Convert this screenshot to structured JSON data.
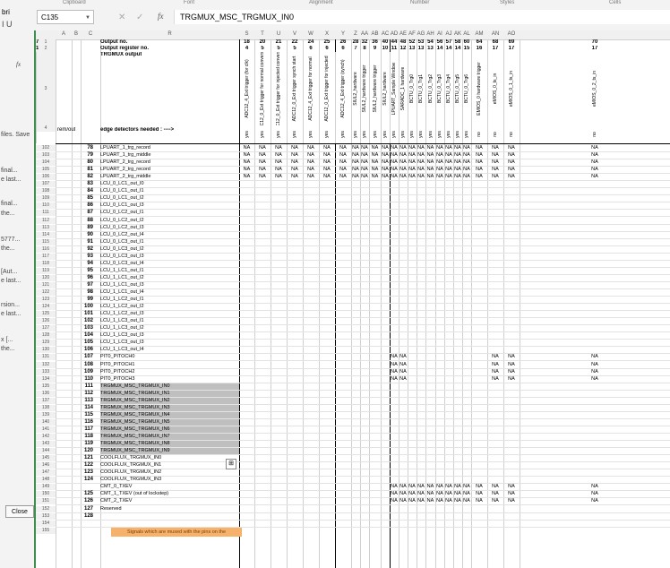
{
  "ribbon": {
    "groups": [
      "Clipboard",
      "Font",
      "Alignment",
      "Number",
      "Styles",
      "Cells"
    ]
  },
  "font": {
    "name": "bri",
    "buttons": "I  U"
  },
  "name_box": {
    "value": "C135"
  },
  "formula_bar": {
    "fx": "fx",
    "value": "TRGMUX_MSC_TRGMUX_IN0",
    "cancel": "✕",
    "confirm": "✓"
  },
  "left_panel": {
    "fx_label": "fx",
    "items": [
      "files. Save",
      "final...",
      "e last...",
      "final...",
      "the...",
      "5777...",
      "the...",
      "[Aut...",
      "e last...",
      "rsion...",
      "e last...",
      "x [...",
      "the..."
    ],
    "close_label": "Close"
  },
  "columns": [
    "A",
    "B",
    "C",
    "R",
    "S",
    "T",
    "U",
    "V",
    "W",
    "X",
    "Y",
    "Z",
    "AA",
    "AB",
    "AC",
    "AD",
    "AE",
    "AF",
    "AG",
    "AH",
    "AI",
    "AJ",
    "AK",
    "AL",
    "AM",
    "AN",
    "AO"
  ],
  "header": {
    "output_no_label": "Output no.",
    "output_reg_label": "Output register no.",
    "trgmux_label": "TRGMUX output",
    "edge_label": "edge detectors needed : ---->",
    "row4_left": "rem/out",
    "output_no": [
      "18",
      "20",
      "21",
      "22",
      "24",
      "25",
      "26",
      "28",
      "32",
      "36",
      "40",
      "44",
      "48",
      "52",
      "53",
      "54",
      "56",
      "57",
      "58",
      "60",
      "64",
      "68",
      "69",
      "70",
      "7"
    ],
    "output_reg": [
      "4",
      "5",
      "5",
      "5",
      "6",
      "6",
      "6",
      "7",
      "8",
      "9",
      "10",
      "11",
      "12",
      "13",
      "13",
      "13",
      "14",
      "14",
      "14",
      "15",
      "16",
      "17",
      "17",
      "17",
      "1"
    ],
    "outputs": [
      "ADC12_4_Ext trigger (for clk)",
      "ADC12_0_Ext trigger for normal conversion",
      "ADC12_0_Ext trigger for injected conversion",
      "ADC12_0_Ext trigger synch start",
      "ADC12_4_Ext trigger for normal",
      "ADC12_0_Ext trigger for injected",
      "ADC12_4_Ext trigger (synch)",
      "SIUL2_hardware",
      "SIUL2_hardware trigger",
      "SIUL2_hardware trigger",
      "SIUL2_hardware",
      "LPUART_Sample Window",
      "SARADC_1 hardware",
      "BCTU_0_Trg0",
      "BCTU_0_Trg1",
      "BCTU_0_Trg2",
      "BCTU_0_Trg3",
      "BCTU_0_Trg4",
      "BCTU_0_Trg5",
      "BCTU_0_Trg6",
      "EMIOS_0 hardware trigger",
      "eMIOS_0_ts_in",
      "eMIOS_0_1_ts_in",
      "eMIOS_0_2_ts_in",
      "eMIOS_0"
    ],
    "edge": [
      "yes",
      "yes",
      "yes",
      "yes",
      "yes",
      "yes",
      "yes",
      "yes",
      "yes",
      "yes",
      "yes",
      "yes",
      "yes",
      "yes",
      "yes",
      "yes",
      "yes",
      "yes",
      "yes",
      "yes",
      "no",
      "no",
      "no",
      "no",
      "n"
    ]
  },
  "rows": [
    {
      "rn": "102",
      "num": "78",
      "sig": "LPUART_1_trg_record",
      "na": "full"
    },
    {
      "rn": "103",
      "num": "79",
      "sig": "LPUART_1_trg_middle",
      "na": "full"
    },
    {
      "rn": "104",
      "num": "80",
      "sig": "LPUART_2_trg_record",
      "na": "full"
    },
    {
      "rn": "105",
      "num": "81",
      "sig": "LPUART_2_trg_record",
      "na": "full"
    },
    {
      "rn": "106",
      "num": "82",
      "sig": "LPUART_2_trg_middle",
      "na": "full"
    },
    {
      "rn": "107",
      "num": "83",
      "sig": "LCU_0_LC1_out_I0",
      "na": "none"
    },
    {
      "rn": "108",
      "num": "84",
      "sig": "LCU_0_LC1_out_I1",
      "na": "none"
    },
    {
      "rn": "109",
      "num": "85",
      "sig": "LCU_0_LC1_out_I2",
      "na": "none"
    },
    {
      "rn": "110",
      "num": "86",
      "sig": "LCU_0_LC1_out_I3",
      "na": "none"
    },
    {
      "rn": "111",
      "num": "87",
      "sig": "LCU_0_LC2_out_I1",
      "na": "none"
    },
    {
      "rn": "112",
      "num": "88",
      "sig": "LCU_0_LC2_out_I2",
      "na": "none"
    },
    {
      "rn": "113",
      "num": "89",
      "sig": "LCU_0_LC2_out_I3",
      "na": "none"
    },
    {
      "rn": "114",
      "num": "90",
      "sig": "LCU_0_LC2_out_I4",
      "na": "none"
    },
    {
      "rn": "115",
      "num": "91",
      "sig": "LCU_0_LC3_out_I1",
      "na": "none"
    },
    {
      "rn": "116",
      "num": "92",
      "sig": "LCU_0_LC3_out_I2",
      "na": "none"
    },
    {
      "rn": "117",
      "num": "93",
      "sig": "LCU_0_LC3_out_I3",
      "na": "none"
    },
    {
      "rn": "118",
      "num": "94",
      "sig": "LCU_0_LC3_out_I4",
      "na": "none"
    },
    {
      "rn": "119",
      "num": "95",
      "sig": "LCU_1_LC1_out_I1",
      "na": "none"
    },
    {
      "rn": "120",
      "num": "96",
      "sig": "LCU_1_LC1_out_I2",
      "na": "none"
    },
    {
      "rn": "121",
      "num": "97",
      "sig": "LCU_1_LC1_out_I3",
      "na": "none"
    },
    {
      "rn": "122",
      "num": "98",
      "sig": "LCU_1_LC1_out_I4",
      "na": "none"
    },
    {
      "rn": "123",
      "num": "99",
      "sig": "LCU_1_LC2_out_I1",
      "na": "none"
    },
    {
      "rn": "124",
      "num": "100",
      "sig": "LCU_1_LC2_out_I2",
      "na": "none"
    },
    {
      "rn": "125",
      "num": "101",
      "sig": "LCU_1_LC2_out_I3",
      "na": "none"
    },
    {
      "rn": "126",
      "num": "102",
      "sig": "LCU_1_LC3_out_I1",
      "na": "none"
    },
    {
      "rn": "127",
      "num": "103",
      "sig": "LCU_1_LC3_out_I2",
      "na": "none"
    },
    {
      "rn": "128",
      "num": "104",
      "sig": "LCU_1_LC3_out_I3",
      "na": "none"
    },
    {
      "rn": "129",
      "num": "105",
      "sig": "LCU_1_LC3_out_I3",
      "na": "none"
    },
    {
      "rn": "130",
      "num": "106",
      "sig": "LCU_1_LC3_out_I4",
      "na": "none"
    },
    {
      "rn": "131",
      "num": "107",
      "sig": "PIT0_PITOCH0",
      "na": "partial"
    },
    {
      "rn": "132",
      "num": "108",
      "sig": "PIT0_PITOCH1",
      "na": "partial"
    },
    {
      "rn": "133",
      "num": "109",
      "sig": "PIT0_PITOCH2",
      "na": "partial"
    },
    {
      "rn": "134",
      "num": "110",
      "sig": "PIT0_PITOCH3",
      "na": "partial"
    },
    {
      "rn": "135",
      "num": "111",
      "sig": "TRGMUX_MSC_TRGMUX_IN0",
      "na": "none",
      "hl": true
    },
    {
      "rn": "136",
      "num": "112",
      "sig": "TRGMUX_MSC_TRGMUX_IN1",
      "na": "none",
      "hl": true
    },
    {
      "rn": "137",
      "num": "113",
      "sig": "TRGMUX_MSC_TRGMUX_IN2",
      "na": "none",
      "hl": true
    },
    {
      "rn": "138",
      "num": "114",
      "sig": "TRGMUX_MSC_TRGMUX_IN3",
      "na": "none",
      "hl": true
    },
    {
      "rn": "139",
      "num": "115",
      "sig": "TRGMUX_MSC_TRGMUX_IN4",
      "na": "none",
      "hl": true
    },
    {
      "rn": "140",
      "num": "116",
      "sig": "TRGMUX_MSC_TRGMUX_IN5",
      "na": "none",
      "hl": true
    },
    {
      "rn": "141",
      "num": "117",
      "sig": "TRGMUX_MSC_TRGMUX_IN6",
      "na": "none",
      "hl": true
    },
    {
      "rn": "142",
      "num": "118",
      "sig": "TRGMUX_MSC_TRGMUX_IN7",
      "na": "none",
      "hl": true
    },
    {
      "rn": "143",
      "num": "119",
      "sig": "TRGMUX_MSC_TRGMUX_IN8",
      "na": "none",
      "hl": true
    },
    {
      "rn": "144",
      "num": "120",
      "sig": "TRGMUX_MSC_TRGMUX_IN9",
      "na": "none",
      "hl": true
    },
    {
      "rn": "145",
      "num": "121",
      "sig": "COOLFLUX_TRGMUX_IN0",
      "na": "none"
    },
    {
      "rn": "146",
      "num": "122",
      "sig": "COOLFLUX_TRGMUX_IN1",
      "na": "none"
    },
    {
      "rn": "147",
      "num": "123",
      "sig": "COOLFLUX_TRGMUX_IN2",
      "na": "none"
    },
    {
      "rn": "148",
      "num": "124",
      "sig": "COOLFLUX_TRGMUX_IN3",
      "na": "none"
    },
    {
      "rn": "149",
      "num": "",
      "sig": "CMT_0_TXEV",
      "na": "wide"
    },
    {
      "rn": "150",
      "num": "125",
      "sig": "CMT_1_TXEV (out of lockstep)",
      "na": "wide"
    },
    {
      "rn": "151",
      "num": "126",
      "sig": "CMT_2_TXEV",
      "na": "wide"
    },
    {
      "rn": "152",
      "num": "127",
      "sig": "Reserved",
      "na": "none"
    },
    {
      "rn": "153",
      "num": "128",
      "sig": "",
      "na": "none"
    },
    {
      "rn": "154",
      "num": "",
      "sig": "",
      "na": "none"
    }
  ],
  "na_text": "NA",
  "note": {
    "rn": "155",
    "text": "Signals which are muxed with the pins on the"
  },
  "paste_icon": "⊞"
}
